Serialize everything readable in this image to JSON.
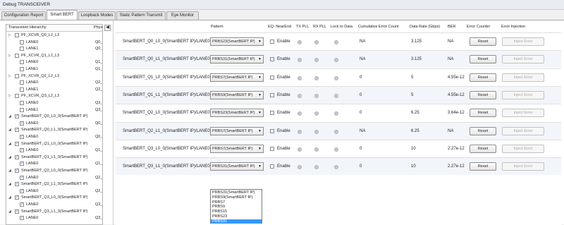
{
  "window": {
    "title": "Debug TRANSCEIVER"
  },
  "tabs": [
    {
      "label": "Configuration Report",
      "active": false
    },
    {
      "label": "Smart BERT",
      "active": true
    },
    {
      "label": "Loopback Modes",
      "active": false
    },
    {
      "label": "Static Pattern Transmit",
      "active": false
    },
    {
      "label": "Eye Monitor",
      "active": false
    }
  ],
  "tree": {
    "headers": {
      "hierarchy": "Transceiver Hierarchy",
      "phy": "Phys"
    },
    "collapse_glyph": "◀",
    "items": [
      {
        "label": "PF_XCVR_Q0_L2_L3",
        "phy": "",
        "level": 0,
        "checked": false
      },
      {
        "label": "LANE0",
        "phy": "Q0_",
        "level": 1,
        "checked": false
      },
      {
        "label": "LANE1",
        "phy": "Q0_",
        "level": 1,
        "checked": false
      },
      {
        "label": "PF_XCVR_Q1_L2_L3",
        "phy": "",
        "level": 0,
        "checked": false
      },
      {
        "label": "LANE0",
        "phy": "Q1_",
        "level": 1,
        "checked": false
      },
      {
        "label": "LANE1",
        "phy": "Q1_",
        "level": 1,
        "checked": false
      },
      {
        "label": "PF_XCVR_Q2_L2_L3",
        "phy": "",
        "level": 0,
        "checked": false
      },
      {
        "label": "LANE0",
        "phy": "Q2_",
        "level": 1,
        "checked": false
      },
      {
        "label": "LANE1",
        "phy": "Q2_",
        "level": 1,
        "checked": false
      },
      {
        "label": "PF_XCVR_Q3_L2_L3",
        "phy": "",
        "level": 0,
        "checked": false
      },
      {
        "label": "LANE0",
        "phy": "Q3_",
        "level": 1,
        "checked": false
      },
      {
        "label": "LANE1",
        "phy": "Q3_",
        "level": 1,
        "checked": false
      },
      {
        "label": "SmartBERT_Q0_L0_0(SmartBERT IP)",
        "phy": "",
        "level": 0,
        "checked": true
      },
      {
        "label": "LANE0",
        "phy": "Q0_",
        "level": 1,
        "checked": true
      },
      {
        "label": "SmartBERT_Q0_L1_0(SmartBERT IP)",
        "phy": "",
        "level": 0,
        "checked": true
      },
      {
        "label": "LANE0",
        "phy": "Q0_",
        "level": 1,
        "checked": true
      },
      {
        "label": "SmartBERT_Q1_L0_0(SmartBERT IP)",
        "phy": "",
        "level": 0,
        "checked": true
      },
      {
        "label": "LANE0",
        "phy": "Q1_",
        "level": 1,
        "checked": true
      },
      {
        "label": "SmartBERT_Q1_L1_0(SmartBERT IP)",
        "phy": "",
        "level": 0,
        "checked": true
      },
      {
        "label": "LANE0",
        "phy": "Q1_",
        "level": 1,
        "checked": true
      },
      {
        "label": "SmartBERT_Q2_L0_0(SmartBERT IP)",
        "phy": "",
        "level": 0,
        "checked": true
      },
      {
        "label": "LANE0",
        "phy": "Q2_",
        "level": 1,
        "checked": true
      },
      {
        "label": "SmartBERT_Q2_L1_0(SmartBERT IP)",
        "phy": "",
        "level": 0,
        "checked": true
      },
      {
        "label": "LANE0",
        "phy": "Q2_",
        "level": 1,
        "checked": true
      },
      {
        "label": "SmartBERT_Q3_L0_0(SmartBERT IP)",
        "phy": "",
        "level": 0,
        "checked": true
      },
      {
        "label": "LANE0",
        "phy": "Q3_",
        "level": 1,
        "checked": true
      },
      {
        "label": "SmartBERT_Q3_L1_0(SmartBERT IP)",
        "phy": "",
        "level": 0,
        "checked": true
      },
      {
        "label": "LANE0",
        "phy": "Q3_",
        "level": 1,
        "checked": true
      }
    ]
  },
  "table": {
    "headers": {
      "pattern": "Pattern",
      "eq_nearend": "EQ- NearEnd",
      "tx_pll": "TX PLL",
      "rx_pll": "RX PLL",
      "lock_to_data": "Lock to Data",
      "cum_error": "Cumulative Error Count",
      "data_rate": "Data Rate (Gbps)",
      "ber": "BER",
      "error_counter": "Error Counter",
      "error_injection": "Error Injection"
    },
    "enable_label": "Enable",
    "reset_label": "Reset",
    "inject_label": "Inject Error",
    "dropdown_glyph": "▼",
    "rows": [
      {
        "name": "SmartBERT_Q0_L0_0(SmartBERT IP)/LANE0",
        "pattern": "PRBS23(SmartBERT IP)",
        "errors": "NA",
        "rate": "3.125",
        "ber": "NA"
      },
      {
        "name": "SmartBERT_Q0_L1_0(SmartBERT IP)/LANE0",
        "pattern": "PRBS31(SmartBERT IP)",
        "errors": "NA",
        "rate": "3.125",
        "ber": "NA"
      },
      {
        "name": "SmartBERT_Q1_L0_0(SmartBERT IP)/LANE0",
        "pattern": "PRBS7(SmartBERT IP)",
        "errors": "0",
        "rate": "5",
        "ber": "4.55e-12"
      },
      {
        "name": "SmartBERT_Q1_L1_0(SmartBERT IP)/LANE0",
        "pattern": "PRBS9(SmartBERT IP)",
        "errors": "0",
        "rate": "5",
        "ber": "4.55e-12"
      },
      {
        "name": "SmartBERT_Q2_L0_0(SmartBERT IP)/LANE0",
        "pattern": "PRBS23(SmartBERT IP)",
        "errors": "0",
        "rate": "6.25",
        "ber": "3.64e-12"
      },
      {
        "name": "SmartBERT_Q2_L1_0(SmartBERT IP)/LANE0",
        "pattern": "PRBS7(SmartBERT IP)",
        "errors": "NA",
        "rate": "6.25",
        "ber": "NA"
      },
      {
        "name": "SmartBERT_Q3_L0_0(SmartBERT IP)/LANE0",
        "pattern": "PRBS7(SmartBERT IP)",
        "errors": "0",
        "rate": "10",
        "ber": "2.27e-12"
      },
      {
        "name": "SmartBERT_Q3_L1_0(SmartBERT IP)/LANE0",
        "pattern": "PRBS31(SmartBERT IP)",
        "errors": "0",
        "rate": "10",
        "ber": "2.27e-12"
      }
    ]
  },
  "pattern_dropdown": {
    "options": [
      "PRBS31(SmartBERT IP)",
      "PRBS9(SmartBERT IP)",
      "PRBS7",
      "PRBS9",
      "PRBS15",
      "PRBS23",
      "PRBS31"
    ],
    "selected": "PRBS31"
  },
  "colors": {
    "selection": "#3399ff",
    "row_alt": "#f2f5f9",
    "checkmark": "#1b57b6"
  }
}
